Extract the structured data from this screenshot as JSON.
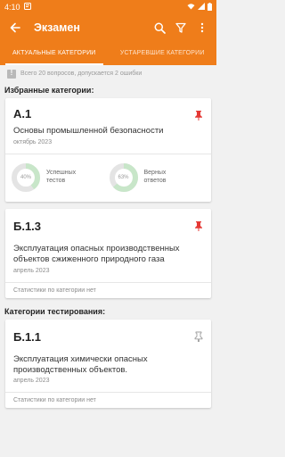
{
  "status_bar": {
    "time": "4:10"
  },
  "app_bar": {
    "title": "Экзамен"
  },
  "tabs": [
    {
      "label": "АКТУАЛЬНЫЕ КАТЕГОРИИ",
      "active": true
    },
    {
      "label": "УСТАРЕВШИЕ КАТЕГОРИИ",
      "active": false
    }
  ],
  "info_text": "Всего 20 вопросов, допускается 2 ошибки",
  "favorites_header": "Избранные категории:",
  "testing_header": "Категории тестирования:",
  "cards": [
    {
      "code": "А.1",
      "name": "Основы промышленной безопасности",
      "date": "октябрь 2023",
      "pinned": true,
      "stats": [
        {
          "percent": "40%",
          "value": 40,
          "label_line1": "Успешных",
          "label_line2": "тестов"
        },
        {
          "percent": "63%",
          "value": 63,
          "label_line1": "Верных",
          "label_line2": "ответов"
        }
      ]
    },
    {
      "code": "Б.1.3",
      "name": "Эксплуатация опасных производственных объектов сжиженного природного газа",
      "date": "апрель 2023",
      "pinned": true,
      "no_stats": "Статистики по категории нет"
    },
    {
      "code": "Б.1.1",
      "name": "Эксплуатация химически опасных производственных объектов.",
      "date": "апрель 2023",
      "pinned": false,
      "no_stats": "Статистики по категории нет"
    }
  ],
  "colors": {
    "accent": "#ef7d1a",
    "pin_active": "#e53935",
    "pin_inactive": "#9e9e9e",
    "donut_track": "#e4e4e4",
    "donut_fill": "#c8e6c9"
  }
}
